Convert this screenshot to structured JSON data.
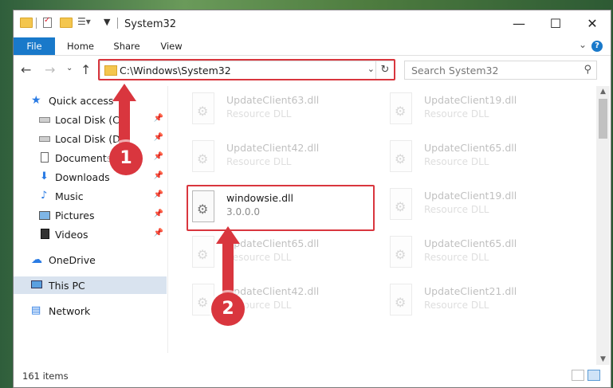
{
  "window": {
    "title": "System32",
    "controls": {
      "minimize": "—",
      "maximize": "☐",
      "close": "✕"
    }
  },
  "ribbon": {
    "tabs": [
      {
        "label": "File"
      },
      {
        "label": "Home"
      },
      {
        "label": "Share"
      },
      {
        "label": "View"
      }
    ],
    "accent_color": "#1979ca"
  },
  "navigation": {
    "address": "C:\\Windows\\System32",
    "search_placeholder": "Search System32"
  },
  "sidebar": {
    "items": [
      {
        "label": "Quick access",
        "icon": "star-icon"
      },
      {
        "label": "Local Disk (C:)",
        "icon": "drive-icon",
        "pinned": true
      },
      {
        "label": "Local Disk (D:)",
        "icon": "drive-icon",
        "pinned": true
      },
      {
        "label": "Documents",
        "icon": "documents-icon",
        "pinned": true
      },
      {
        "label": "Downloads",
        "icon": "download-icon",
        "pinned": true
      },
      {
        "label": "Music",
        "icon": "music-icon",
        "pinned": true
      },
      {
        "label": "Pictures",
        "icon": "pictures-icon",
        "pinned": true
      },
      {
        "label": "Videos",
        "icon": "videos-icon",
        "pinned": true
      },
      {
        "label": "OneDrive",
        "icon": "cloud-icon"
      },
      {
        "label": "This PC",
        "icon": "computer-icon",
        "selected": true
      },
      {
        "label": "Network",
        "icon": "network-icon"
      }
    ]
  },
  "files": [
    {
      "name": "UpdateClient63.dll",
      "type": "Resource DLL"
    },
    {
      "name": "UpdateClient19.dll",
      "type": "Resource DLL"
    },
    {
      "name": "UpdateClient42.dll",
      "type": "Resource DLL"
    },
    {
      "name": "UpdateClient65.dll",
      "type": "Resource DLL"
    },
    {
      "name": "windowsie.dll",
      "type": "3.0.0.0"
    },
    {
      "name": "UpdateClient19.dll",
      "type": "Resource DLL"
    },
    {
      "name": "UpdateClient65.dll",
      "type": "Resource DLL"
    },
    {
      "name": "UpdateClient65.dll",
      "type": "Resource DLL"
    },
    {
      "name": "UpdateClient42.dll",
      "type": "Resource DLL"
    },
    {
      "name": "UpdateClient21.dll",
      "type": "Resource DLL"
    }
  ],
  "status": {
    "item_count": "161 items"
  },
  "annotations": {
    "step1": "1",
    "step2": "2",
    "color": "#d9363e"
  }
}
